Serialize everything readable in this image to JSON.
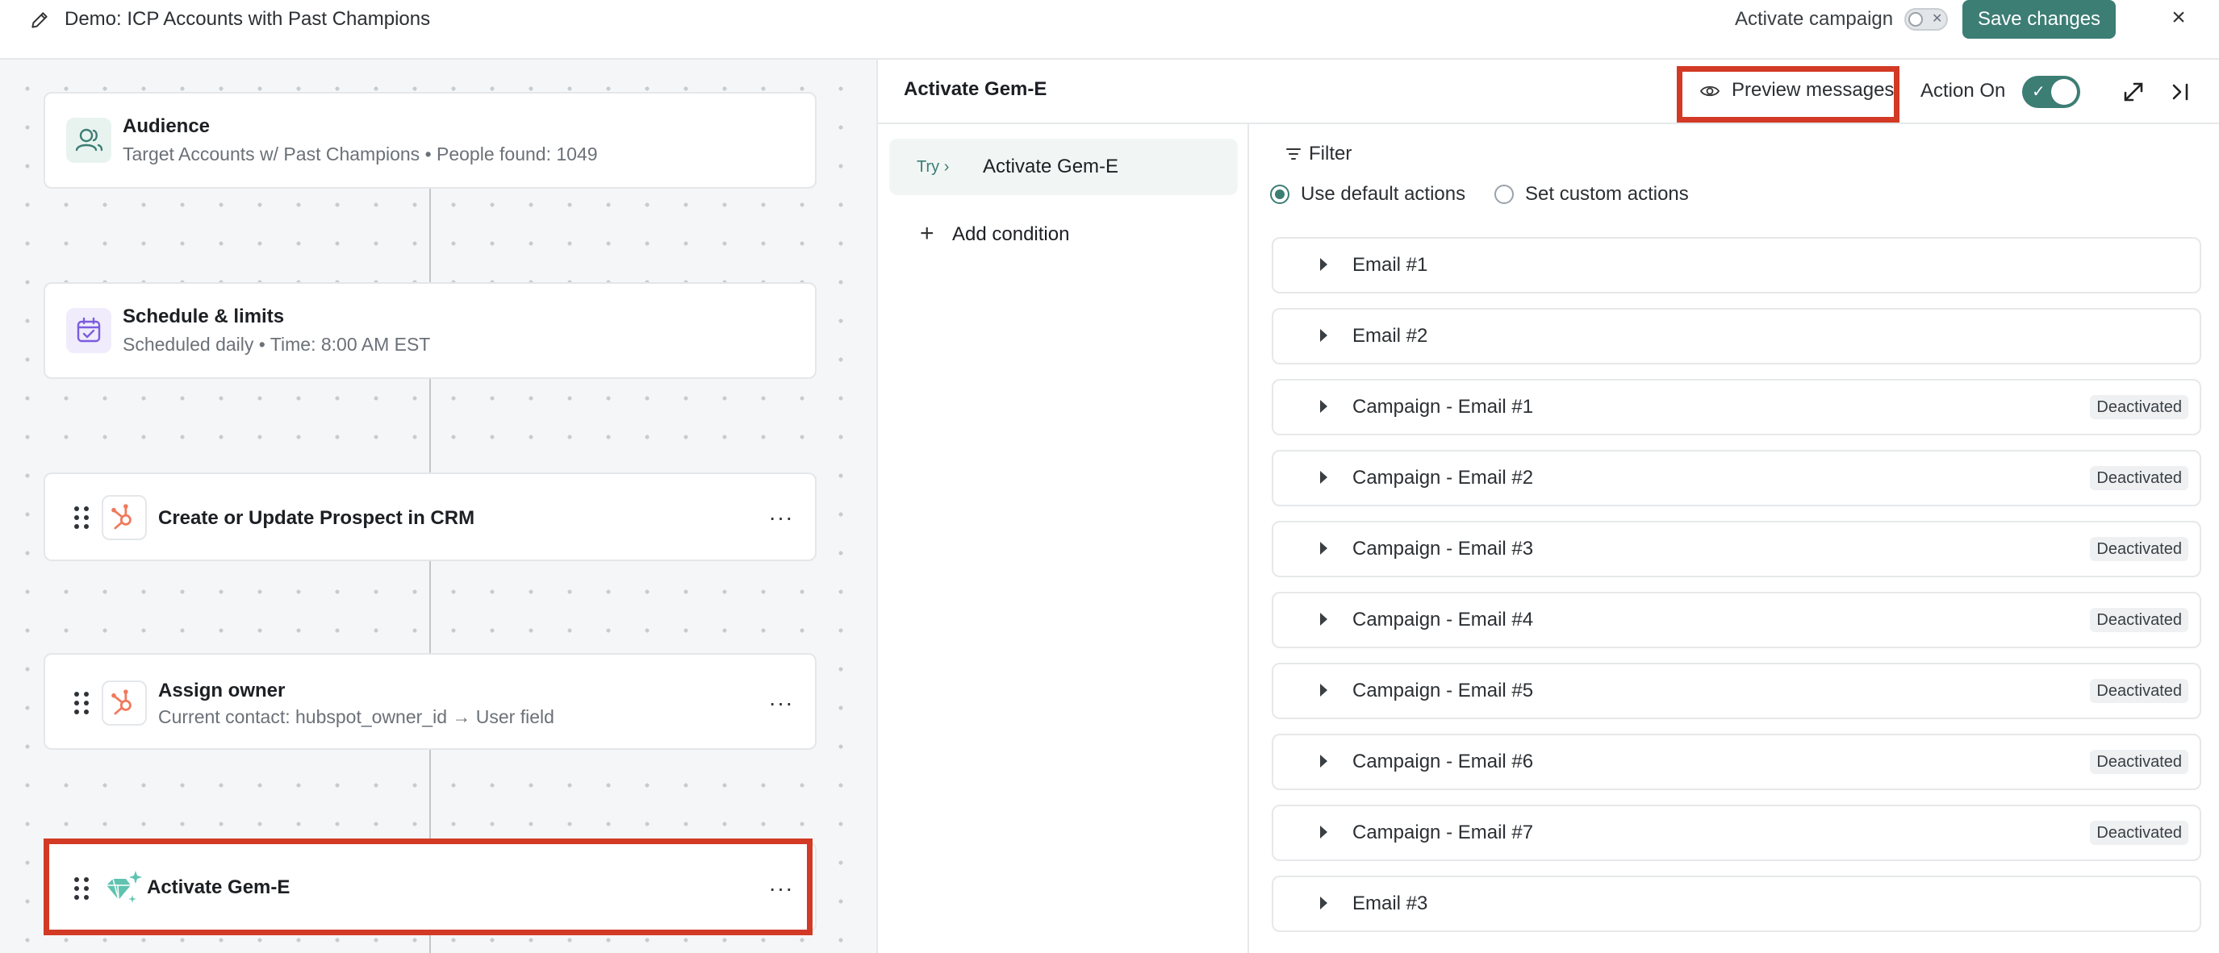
{
  "header": {
    "title": "Demo: ICP Accounts with Past Champions",
    "activate_label": "Activate campaign",
    "save_label": "Save changes",
    "close_glyph": "×"
  },
  "workflow": {
    "audience": {
      "title": "Audience",
      "subtitle": "Target Accounts w/ Past Champions • People found: 1049",
      "icon": "people-icon"
    },
    "schedule": {
      "title": "Schedule & limits",
      "subtitle": "Scheduled daily • Time: 8:00 AM EST",
      "icon": "calendar-icon"
    },
    "crm": {
      "title": "Create or Update Prospect in CRM",
      "icon": "hubspot-icon"
    },
    "owner": {
      "title": "Assign owner",
      "subtitle": "Current contact: hubspot_owner_id → User field",
      "icon": "hubspot-icon"
    },
    "gem": {
      "title": "Activate Gem-E",
      "icon": "gem-sparkle-icon"
    },
    "more_glyph": "···"
  },
  "panel": {
    "title": "Activate Gem-E",
    "preview_label": "Preview messages",
    "action_on_label": "Action On",
    "action_on": true,
    "condition": {
      "try_label": "Try ›",
      "label": "Activate Gem-E"
    },
    "add_condition_label": "Add condition",
    "filter_label": "Filter",
    "radio_default": "Use default actions",
    "radio_custom": "Set custom actions",
    "actions": [
      {
        "label": "Email #1",
        "badge": ""
      },
      {
        "label": "Email #2",
        "badge": ""
      },
      {
        "label": "Campaign - Email #1",
        "badge": "Deactivated"
      },
      {
        "label": "Campaign - Email #2",
        "badge": "Deactivated"
      },
      {
        "label": "Campaign - Email #3",
        "badge": "Deactivated"
      },
      {
        "label": "Campaign - Email #4",
        "badge": "Deactivated"
      },
      {
        "label": "Campaign - Email #5",
        "badge": "Deactivated"
      },
      {
        "label": "Campaign - Email #6",
        "badge": "Deactivated"
      },
      {
        "label": "Campaign - Email #7",
        "badge": "Deactivated"
      },
      {
        "label": "Email #3",
        "badge": ""
      }
    ]
  },
  "colors": {
    "accent": "#3c7d74",
    "highlight": "#d23a25",
    "hubspot": "#f0795b",
    "calendar": "#7b5ce0"
  }
}
